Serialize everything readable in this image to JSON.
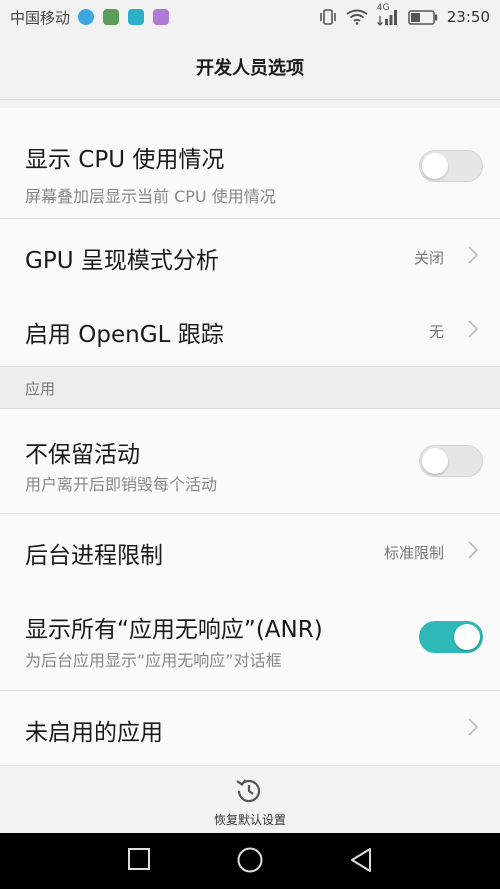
{
  "status_bar": {
    "carrier": "中国移动",
    "network": "4G",
    "time": "23:50"
  },
  "header": {
    "title": "开发人员选项"
  },
  "items": [
    {
      "label": "显示 CPU 使用情况",
      "subtitle": "屏幕叠加层显示当前 CPU 使用情况",
      "toggle": "off"
    },
    {
      "label": "GPU 呈现模式分析",
      "value": "关闭"
    },
    {
      "label": "启用 OpenGL 跟踪",
      "value": "无"
    },
    {
      "label": "不保留活动",
      "subtitle": "用户离开后即销毁每个活动",
      "toggle": "off"
    },
    {
      "label": "后台进程限制",
      "value": "标准限制"
    },
    {
      "label": "显示所有“应用无响应”(ANR)",
      "subtitle": "为后台应用显示“应用无响应”对话框",
      "toggle": "on"
    },
    {
      "label": "未启用的应用"
    }
  ],
  "section": {
    "title": "应用"
  },
  "bottom_action": {
    "label": "恢复默认设置",
    "icon": "restore-history-icon"
  },
  "nav": {
    "icons": [
      "recent-apps-icon",
      "home-icon",
      "back-icon"
    ]
  },
  "colors": {
    "accent": "#2fb8b8",
    "toggle_off": "#e6e6e6",
    "nav_background": "#000000"
  }
}
